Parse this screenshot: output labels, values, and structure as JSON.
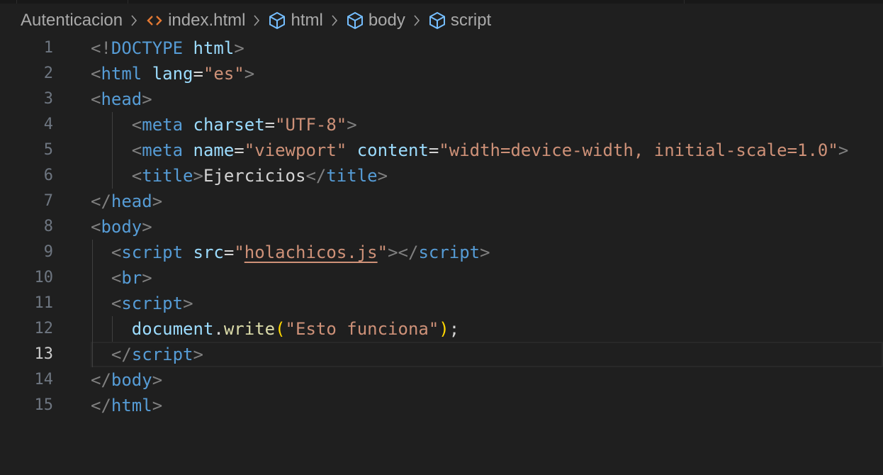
{
  "breadcrumb": [
    "Autenticacion",
    "index.html",
    "html",
    "body",
    "script"
  ],
  "editor": {
    "current_line": 13,
    "lines": [
      {
        "n": "1",
        "tokens": [
          [
            "<!",
            "b"
          ],
          [
            "DOCTYPE",
            "t"
          ],
          [
            " ",
            "x"
          ],
          [
            "html",
            "a"
          ],
          [
            ">",
            "b"
          ]
        ]
      },
      {
        "n": "2",
        "tokens": [
          [
            "<",
            "b"
          ],
          [
            "html",
            "t"
          ],
          [
            " ",
            "x"
          ],
          [
            "lang",
            "a"
          ],
          [
            "=",
            "x"
          ],
          [
            "\"es\"",
            "s"
          ],
          [
            ">",
            "b"
          ]
        ]
      },
      {
        "n": "3",
        "tokens": [
          [
            "<",
            "b"
          ],
          [
            "head",
            "t"
          ],
          [
            ">",
            "b"
          ]
        ]
      },
      {
        "n": "4",
        "tokens": [
          [
            "    ",
            "x"
          ],
          [
            "<",
            "b"
          ],
          [
            "meta",
            "t"
          ],
          [
            " ",
            "x"
          ],
          [
            "charset",
            "a"
          ],
          [
            "=",
            "x"
          ],
          [
            "\"UTF-8\"",
            "s"
          ],
          [
            ">",
            "b"
          ]
        ]
      },
      {
        "n": "5",
        "tokens": [
          [
            "    ",
            "x"
          ],
          [
            "<",
            "b"
          ],
          [
            "meta",
            "t"
          ],
          [
            " ",
            "x"
          ],
          [
            "name",
            "a"
          ],
          [
            "=",
            "x"
          ],
          [
            "\"viewport\"",
            "s"
          ],
          [
            " ",
            "x"
          ],
          [
            "content",
            "a"
          ],
          [
            "=",
            "x"
          ],
          [
            "\"width=device-width, initial-scale=1.0\"",
            "s"
          ],
          [
            ">",
            "b"
          ]
        ]
      },
      {
        "n": "6",
        "tokens": [
          [
            "    ",
            "x"
          ],
          [
            "<",
            "b"
          ],
          [
            "title",
            "t"
          ],
          [
            ">",
            "b"
          ],
          [
            "Ejercicios",
            "x"
          ],
          [
            "</",
            "b"
          ],
          [
            "title",
            "t"
          ],
          [
            ">",
            "b"
          ]
        ]
      },
      {
        "n": "7",
        "tokens": [
          [
            "</",
            "b"
          ],
          [
            "head",
            "t"
          ],
          [
            ">",
            "b"
          ]
        ]
      },
      {
        "n": "8",
        "tokens": [
          [
            "<",
            "b"
          ],
          [
            "body",
            "t"
          ],
          [
            ">",
            "b"
          ]
        ]
      },
      {
        "n": "9",
        "tokens": [
          [
            "  ",
            "x"
          ],
          [
            "<",
            "b"
          ],
          [
            "script",
            "t"
          ],
          [
            " ",
            "x"
          ],
          [
            "src",
            "a"
          ],
          [
            "=",
            "x"
          ],
          [
            "\"",
            "s"
          ],
          [
            "holachicos.js",
            "s u"
          ],
          [
            "\"",
            "s"
          ],
          [
            "></",
            "b"
          ],
          [
            "script",
            "t"
          ],
          [
            ">",
            "b"
          ]
        ]
      },
      {
        "n": "10",
        "tokens": [
          [
            "  ",
            "x"
          ],
          [
            "<",
            "b"
          ],
          [
            "br",
            "t"
          ],
          [
            ">",
            "b"
          ]
        ]
      },
      {
        "n": "11",
        "tokens": [
          [
            "  ",
            "x"
          ],
          [
            "<",
            "b"
          ],
          [
            "script",
            "t"
          ],
          [
            ">",
            "b"
          ]
        ]
      },
      {
        "n": "12",
        "tokens": [
          [
            "    ",
            "x"
          ],
          [
            "document",
            "a"
          ],
          [
            ".",
            "x"
          ],
          [
            "write",
            "f"
          ],
          [
            "(",
            "p"
          ],
          [
            "\"Esto funciona\"",
            "s"
          ],
          [
            ")",
            "p"
          ],
          [
            ";",
            "x"
          ]
        ]
      },
      {
        "n": "13",
        "tokens": [
          [
            "  ",
            "x"
          ],
          [
            "</",
            "b"
          ],
          [
            "script",
            "t"
          ],
          [
            ">",
            "b"
          ]
        ]
      },
      {
        "n": "14",
        "tokens": [
          [
            "</",
            "b"
          ],
          [
            "body",
            "t"
          ],
          [
            ">",
            "b"
          ]
        ]
      },
      {
        "n": "15",
        "tokens": [
          [
            "</",
            "b"
          ],
          [
            "html",
            "t"
          ],
          [
            ">",
            "b"
          ]
        ]
      }
    ]
  }
}
